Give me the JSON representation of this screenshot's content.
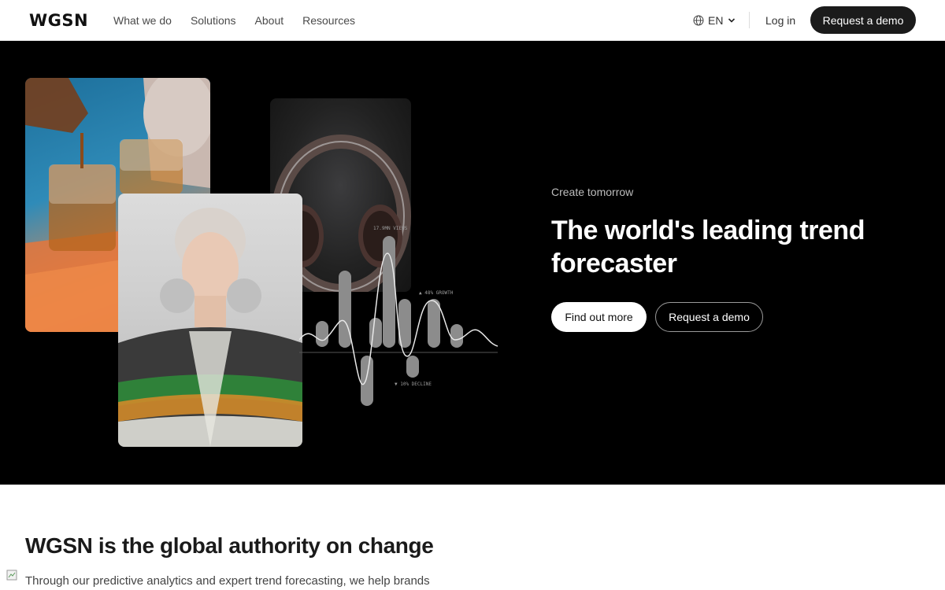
{
  "header": {
    "logo": "WGSN",
    "nav": [
      "What we do",
      "Solutions",
      "About",
      "Resources"
    ],
    "language": "EN",
    "login": "Log in",
    "cta": "Request a demo"
  },
  "hero": {
    "eyebrow": "Create tomorrow",
    "headline": "The world's leading trend forecaster",
    "primary_button": "Find out more",
    "secondary_button": "Request a demo",
    "chart_labels": {
      "views": "17.9MN VIEWS",
      "growth": "▲ 48% GROWTH",
      "decline": "▼ 10% DECLINE"
    }
  },
  "authority": {
    "title": "WGSN is the global authority on change",
    "body": "Through our predictive analytics and expert trend forecasting, we help brands"
  },
  "icons": {
    "language": "globe-icon",
    "dropdown": "chevron-down-icon"
  },
  "colors": {
    "hero_bg": "#000000",
    "primary_dark": "#1b1b1b",
    "text_light": "#ffffff"
  }
}
